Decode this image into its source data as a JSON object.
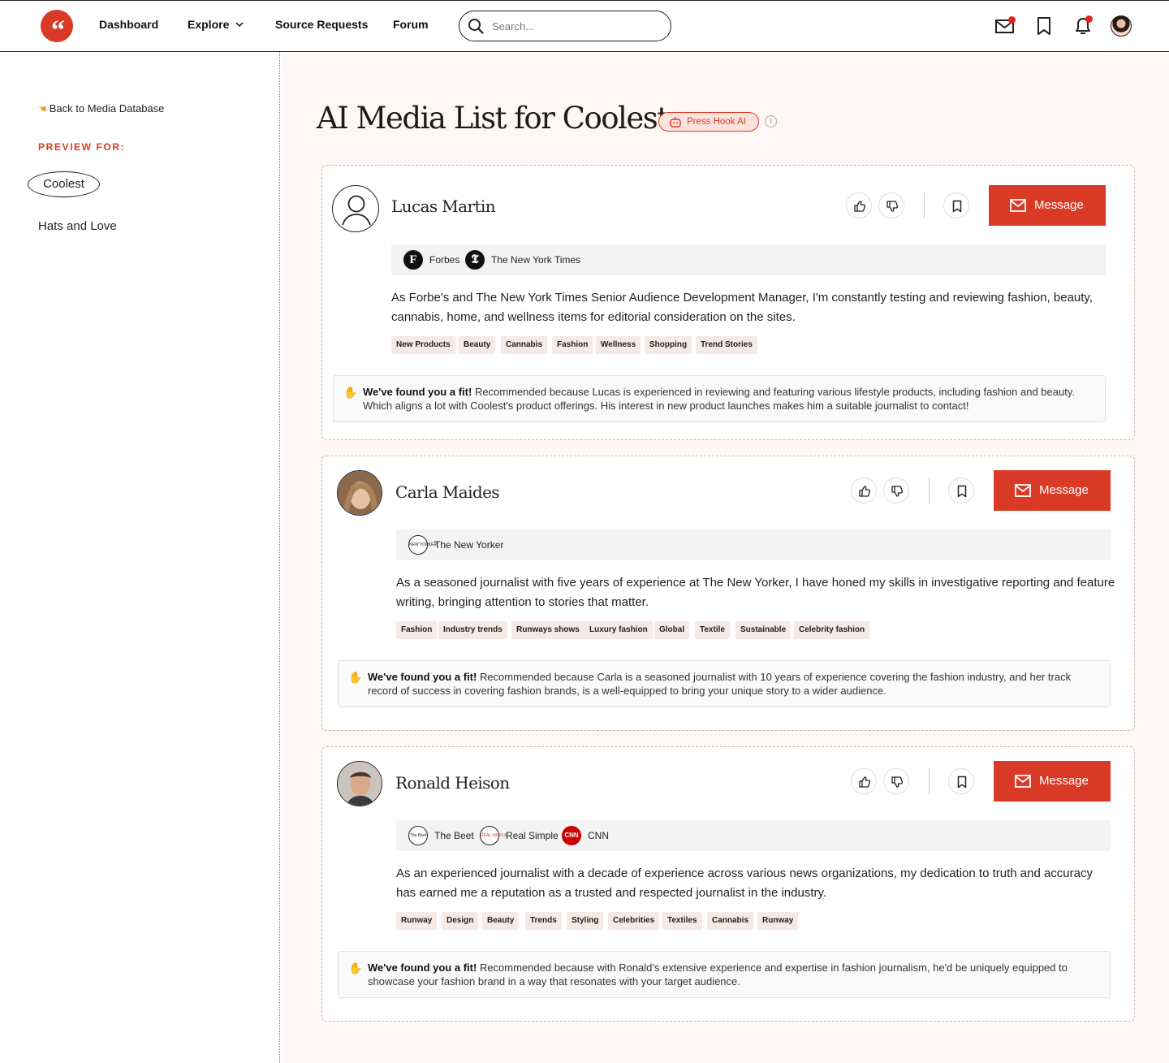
{
  "nav": {
    "logo_glyph": "“",
    "links": [
      "Dashboard",
      "Explore",
      "Source Requests",
      "Forum"
    ],
    "search_placeholder": "Search..."
  },
  "sidebar": {
    "back_label": "Back to Media Database",
    "preview_label": "PREVIEW FOR:",
    "items": [
      "Coolest",
      "Hats and Love"
    ]
  },
  "main": {
    "title": "AI Media List for Coolest",
    "badge": "Press Hook AI",
    "info_glyph": "i",
    "message_label": "Message",
    "fit_lead": "We've found you a fit!",
    "cards": [
      {
        "name": "Lucas Martin",
        "outlets": [
          "Forbes",
          "The New York Times"
        ],
        "outlet_glyphs": [
          "F",
          "𝕿"
        ],
        "bio_lines": [
          "As Forbe's and The New York Times Senior Audience Development Manager, I'm constantly testing and reviewing fashion, beauty,",
          "cannabis, home, and wellness items for editorial consideration on the sites."
        ],
        "tags": [
          "New Products",
          "Beauty",
          "Cannabis",
          "Fashion",
          "Wellness",
          "Shopping",
          "Trend Stories"
        ],
        "fit_lines": [
          "Recommended because Lucas is experienced in reviewing and featuring various lifestyle products, including fashion and beauty.",
          "Which aligns a lot with Coolest's product offerings. His interest in new product launches makes him a suitable journalist to contact!"
        ]
      },
      {
        "name": "Carla Maides",
        "outlets": [
          "The New Yorker"
        ],
        "outlet_glyphs": [
          "NEW YORKER"
        ],
        "bio_lines": [
          "As a seasoned journalist with five years of experience at The New Yorker, I have honed my skills in investigative reporting and feature",
          "writing, bringing attention to stories that matter."
        ],
        "tags": [
          "Fashion",
          "Industry trends",
          "Runways shows",
          "Luxury fashion",
          "Global",
          "Textile",
          "Sustainable",
          "Celebrity fashion"
        ],
        "fit_lines": [
          "Recommended because Carla is a seasoned journalist with 10 years of experience covering the fashion industry, and her  track",
          "record of success in covering fashion brands, is a well-equipped to bring your unique story to a wider audience."
        ]
      },
      {
        "name": "Ronald Heison",
        "outlets": [
          "The Beet",
          "Real Simple",
          "CNN"
        ],
        "outlet_glyphs": [
          "The Beet",
          "REAL SIMPLE",
          "CNN"
        ],
        "bio_lines": [
          "As an experienced journalist with a decade of experience across various news organizations, my dedication to truth and accuracy",
          "has earned me a reputation as a trusted and respected journalist in the industry."
        ],
        "tags": [
          "Runway",
          "Design",
          "Beauty",
          "Trends",
          "Styling",
          "Celebrities",
          "Textiles",
          "Cannabis",
          "Runway"
        ],
        "fit_lines": [
          "Recommended because with Ronald's extensive experience and expertise in fashion journalism, he'd be uniquely equipped to",
          "showcase your fashion brand in a way that resonates with your target audience."
        ]
      }
    ]
  },
  "colors": {
    "accent": "#d93a26",
    "tag_bg": "#f7e9e4",
    "main_bg": "#fdf8f5"
  }
}
